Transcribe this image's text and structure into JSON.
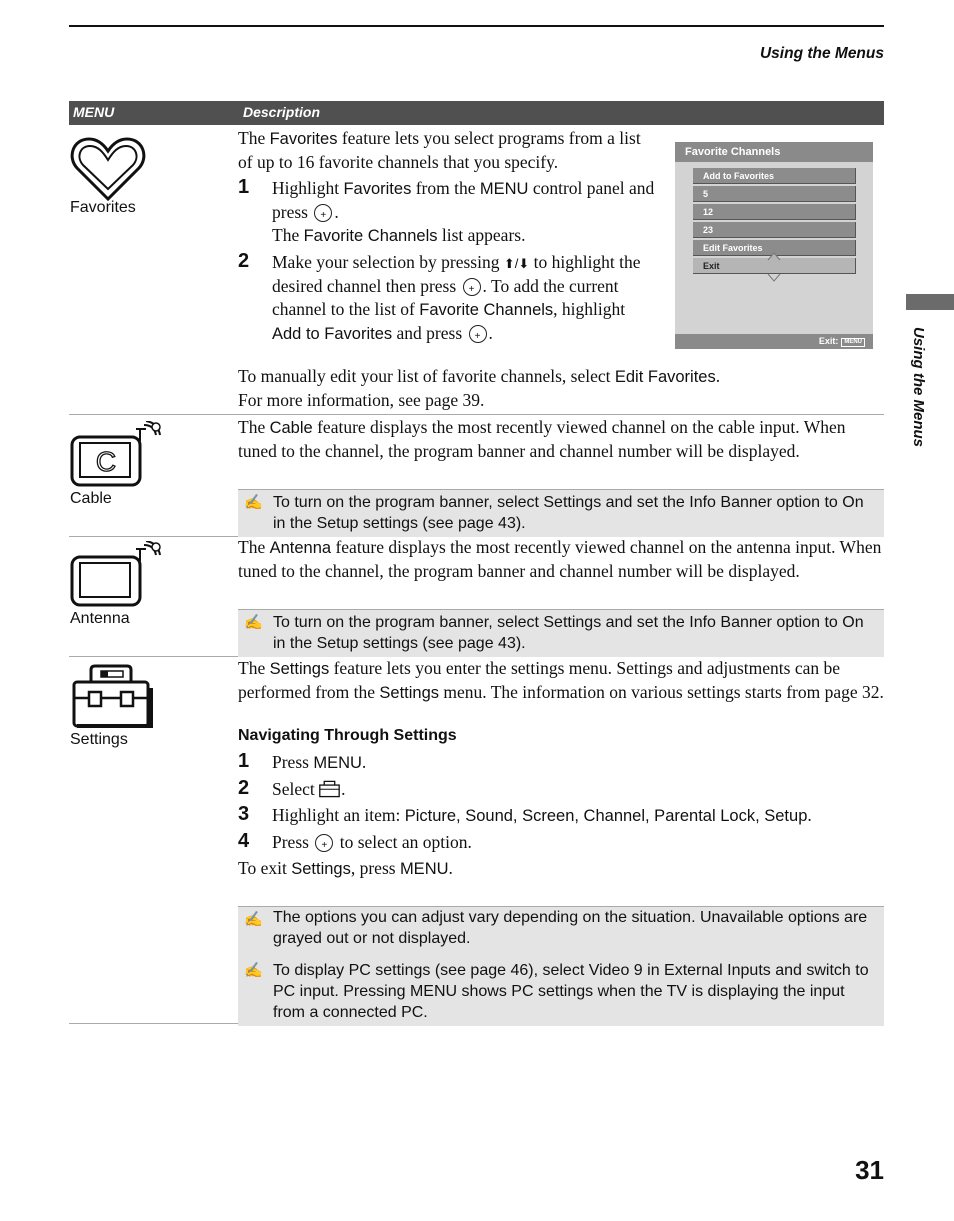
{
  "running_head": "Using the Menus",
  "side_tab": "Using the Menus",
  "page_number": "31",
  "table": {
    "col_menu": "MENU",
    "col_description": "Description"
  },
  "favorites": {
    "label": "Favorites",
    "intro_pre": "The ",
    "intro_term": "Favorites",
    "intro_post": " feature lets you select programs from a list of up to 16 favorite channels that you specify.",
    "step1": {
      "num": "1",
      "a": "Highlight ",
      "b": "Favorites",
      "c": " from the ",
      "d": "MENU",
      "e": " control panel and press ",
      "f": ".",
      "g": "The ",
      "h": "Favorite Channels",
      "i": " list appears."
    },
    "step2": {
      "num": "2",
      "a": "Make your selection by pressing ",
      "arrows": "⬆/⬇",
      "b": " to highlight the desired channel then press ",
      "c": ".",
      "d": "To add the current channel to the list of ",
      "e": "Favorite Channels",
      "f": ", highlight ",
      "g": "Add to Favorites",
      "h": " and press ",
      "i": "."
    },
    "outro1_pre": "To manually edit your list of favorite channels, select ",
    "outro1_term": "Edit Favorites",
    "outro1_post": ".",
    "outro2": "For more information, see page 39.",
    "tv_menu": {
      "title": "Favorite Channels",
      "items": [
        "Add to Favorites",
        "5",
        "12",
        "23",
        "Edit Favorites",
        "Exit"
      ],
      "selected": "Exit",
      "footer": "Exit:",
      "footer_key": "MENU"
    }
  },
  "cable": {
    "label": "Cable",
    "pre": "The ",
    "term": "Cable",
    "post": " feature displays the most recently viewed channel on the cable input. When tuned to the channel, the program banner and channel number will be displayed.",
    "note": "To turn on the program banner, select Settings and set the Info Banner option to On in the Setup settings (see page 43)."
  },
  "antenna": {
    "label": "Antenna",
    "pre": "The ",
    "term": "Antenna",
    "post": " feature displays the most recently viewed channel on the antenna input. When tuned to the channel, the program banner and channel number will be displayed.",
    "note": "To turn on the program banner, select Settings and set the Info Banner option to On in the Setup settings (see page 43)."
  },
  "settings": {
    "label": "Settings",
    "p1": "The ",
    "t1": "Settings",
    "p2": " feature lets you enter the settings menu. Settings and adjustments can be performed from the ",
    "t2": "Settings",
    "p3": " menu. The information on various settings starts from page 32.",
    "nav_heading": "Navigating Through Settings",
    "steps": [
      {
        "num": "1",
        "a": "Press ",
        "b": "MENU",
        "c": "."
      },
      {
        "num": "2",
        "a": "Select ",
        "c": "."
      },
      {
        "num": "3",
        "a": "Highlight an item: ",
        "b": "Picture, Sound, Screen, Channel, Parental Lock, Setup",
        "c": "."
      },
      {
        "num": "4",
        "a": "Press ",
        "c": " to select an option."
      }
    ],
    "exit_a": "To exit ",
    "exit_b": "Settings",
    "exit_c": ", press ",
    "exit_d": "MENU",
    "exit_e": ".",
    "notes": [
      "The options you can adjust vary depending on the situation. Unavailable options are grayed out or not displayed.",
      "To display PC settings (see page 46), select Video 9 in External Inputs and switch to PC input. Pressing MENU shows PC settings when the TV is displaying the input from a connected PC."
    ],
    "note_icon": "✍"
  }
}
